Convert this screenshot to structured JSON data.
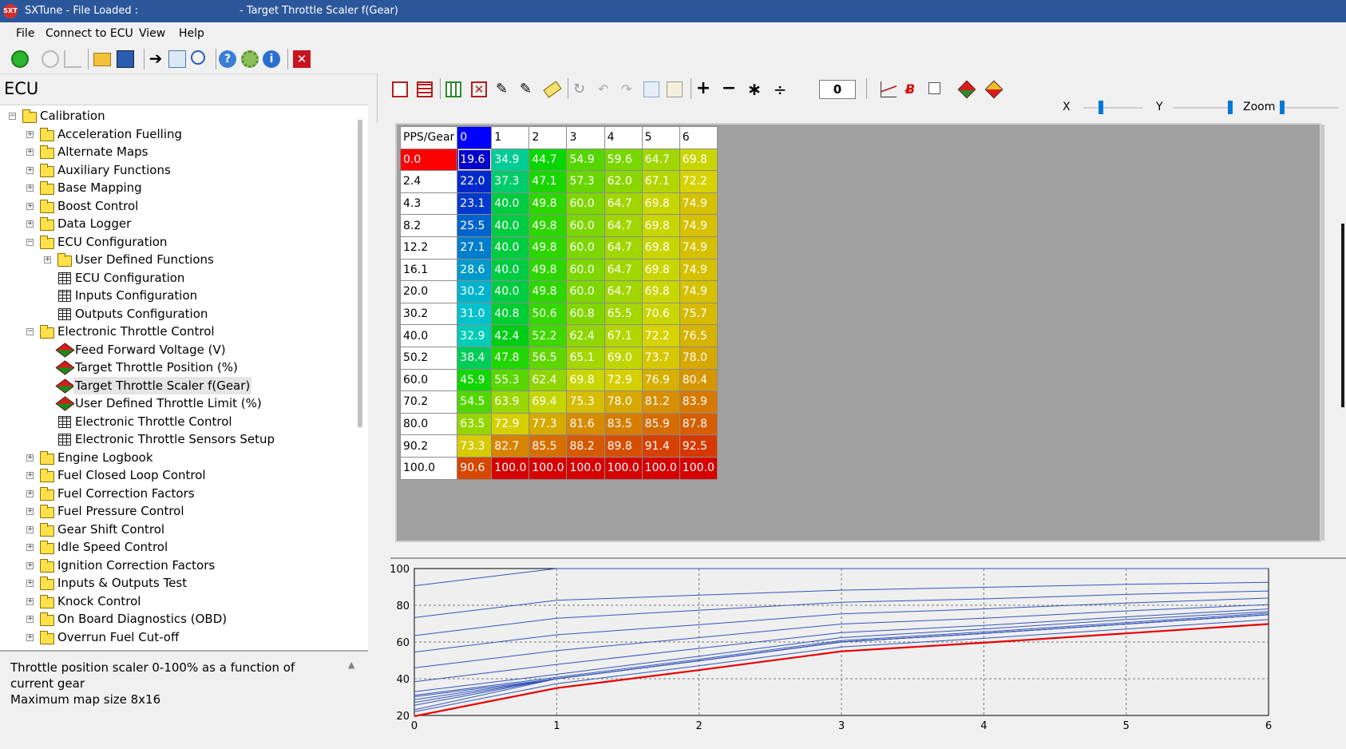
{
  "titlebar": {
    "left": "SXTune - File Loaded :",
    "right": "- Target Throttle Scaler f(Gear)",
    "logo": "SXT"
  },
  "menu": [
    "File",
    "Connect to ECU",
    "View",
    "Help"
  ],
  "toolbar_icons": [
    "power-icon",
    "refresh-icon",
    "graph-icon",
    "open-folder-icon",
    "save-icon",
    "arrow-right-icon",
    "copy-icon",
    "search-icon",
    "help-icon",
    "settings-icon",
    "info-icon",
    "close-icon"
  ],
  "left_panel": {
    "title": "ECU",
    "tree": [
      {
        "label": "Calibration",
        "level": 0,
        "icon": "folder",
        "exp": "-"
      },
      {
        "label": "Acceleration Fuelling",
        "level": 1,
        "icon": "folder",
        "exp": "+"
      },
      {
        "label": "Alternate Maps",
        "level": 1,
        "icon": "folder",
        "exp": "+"
      },
      {
        "label": "Auxiliary Functions",
        "level": 1,
        "icon": "folder",
        "exp": "+"
      },
      {
        "label": "Base Mapping",
        "level": 1,
        "icon": "folder",
        "exp": "+"
      },
      {
        "label": "Boost Control",
        "level": 1,
        "icon": "folder",
        "exp": "+"
      },
      {
        "label": "Data Logger",
        "level": 1,
        "icon": "folder",
        "exp": "+"
      },
      {
        "label": "ECU Configuration",
        "level": 1,
        "icon": "folder",
        "exp": "-"
      },
      {
        "label": "User Defined Functions",
        "level": 2,
        "icon": "folder",
        "exp": "+"
      },
      {
        "label": "ECU Configuration",
        "level": 2,
        "icon": "grid",
        "exp": ""
      },
      {
        "label": "Inputs Configuration",
        "level": 2,
        "icon": "grid",
        "exp": ""
      },
      {
        "label": "Outputs Configuration",
        "level": 2,
        "icon": "grid",
        "exp": ""
      },
      {
        "label": "Electronic Throttle Control",
        "level": 1,
        "icon": "folder",
        "exp": "-"
      },
      {
        "label": "Feed Forward Voltage (V)",
        "level": 2,
        "icon": "cube",
        "exp": ""
      },
      {
        "label": "Target Throttle Position (%)",
        "level": 2,
        "icon": "cube",
        "exp": ""
      },
      {
        "label": "Target Throttle Scaler f(Gear)",
        "level": 2,
        "icon": "cube",
        "exp": "",
        "selected": true
      },
      {
        "label": "User Defined Throttle Limit (%)",
        "level": 2,
        "icon": "cube",
        "exp": ""
      },
      {
        "label": "Electronic Throttle Control",
        "level": 2,
        "icon": "grid",
        "exp": ""
      },
      {
        "label": "Electronic Throttle Sensors Setup",
        "level": 2,
        "icon": "grid",
        "exp": ""
      },
      {
        "label": "Engine Logbook",
        "level": 1,
        "icon": "folder",
        "exp": "+"
      },
      {
        "label": "Fuel Closed Loop Control",
        "level": 1,
        "icon": "folder",
        "exp": "+"
      },
      {
        "label": "Fuel Correction Factors",
        "level": 1,
        "icon": "folder",
        "exp": "+"
      },
      {
        "label": "Fuel Pressure Control",
        "level": 1,
        "icon": "folder",
        "exp": "+"
      },
      {
        "label": "Gear Shift Control",
        "level": 1,
        "icon": "folder",
        "exp": "+"
      },
      {
        "label": "Idle Speed Control",
        "level": 1,
        "icon": "folder",
        "exp": "+"
      },
      {
        "label": "Ignition Correction Factors",
        "level": 1,
        "icon": "folder",
        "exp": "+"
      },
      {
        "label": "Inputs & Outputs Test",
        "level": 1,
        "icon": "folder",
        "exp": "+"
      },
      {
        "label": "Knock Control",
        "level": 1,
        "icon": "folder",
        "exp": "+"
      },
      {
        "label": "On Board Diagnostics (OBD)",
        "level": 1,
        "icon": "folder",
        "exp": "+"
      },
      {
        "label": "Overrun Fuel Cut-off",
        "level": 1,
        "icon": "folder",
        "exp": "+"
      }
    ],
    "description": [
      "Throttle position scaler 0-100% as a function of current gear",
      "Maximum map size 8x16"
    ]
  },
  "map_toolbar": {
    "icons": [
      "insert-row-icon",
      "delete-row-icon",
      "insert-col-icon",
      "delete-col-icon",
      "edit-icon",
      "edit-multi-icon",
      "eraser-icon",
      "rotate-icon",
      "undo-icon",
      "redo-icon",
      "copy-icon",
      "paste-icon",
      "plus-icon",
      "minus-icon",
      "multiply-icon",
      "divide-icon",
      "chart-icon",
      "x-red-icon",
      "checkbox-icon",
      "cube-red-icon",
      "cube-icon"
    ],
    "value": "0",
    "plus": "+",
    "minus": "−",
    "multiply": "∗",
    "divide": "÷",
    "x_label": "X",
    "y_label": "Y",
    "zoom_label": "Zoom"
  },
  "map": {
    "corner": "PPS/Gear",
    "columns": [
      "0",
      "1",
      "2",
      "3",
      "4",
      "5",
      "6"
    ],
    "rows": [
      "0.0",
      "2.4",
      "4.3",
      "8.2",
      "12.2",
      "16.1",
      "20.0",
      "30.2",
      "40.0",
      "50.2",
      "60.0",
      "70.2",
      "80.0",
      "90.2",
      "100.0"
    ],
    "values": [
      [
        "19.6",
        "34.9",
        "44.7",
        "54.9",
        "59.6",
        "64.7",
        "69.8"
      ],
      [
        "22.0",
        "37.3",
        "47.1",
        "57.3",
        "62.0",
        "67.1",
        "72.2"
      ],
      [
        "23.1",
        "40.0",
        "49.8",
        "60.0",
        "64.7",
        "69.8",
        "74.9"
      ],
      [
        "25.5",
        "40.0",
        "49.8",
        "60.0",
        "64.7",
        "69.8",
        "74.9"
      ],
      [
        "27.1",
        "40.0",
        "49.8",
        "60.0",
        "64.7",
        "69.8",
        "74.9"
      ],
      [
        "28.6",
        "40.0",
        "49.8",
        "60.0",
        "64.7",
        "69.8",
        "74.9"
      ],
      [
        "30.2",
        "40.0",
        "49.8",
        "60.0",
        "64.7",
        "69.8",
        "74.9"
      ],
      [
        "31.0",
        "40.8",
        "50.6",
        "60.8",
        "65.5",
        "70.6",
        "75.7"
      ],
      [
        "32.9",
        "42.4",
        "52.2",
        "62.4",
        "67.1",
        "72.2",
        "76.5"
      ],
      [
        "38.4",
        "47.8",
        "56.5",
        "65.1",
        "69.0",
        "73.7",
        "78.0"
      ],
      [
        "45.9",
        "55.3",
        "62.4",
        "69.8",
        "72.9",
        "76.9",
        "80.4"
      ],
      [
        "54.5",
        "63.9",
        "69.4",
        "75.3",
        "78.0",
        "81.2",
        "83.9"
      ],
      [
        "63.5",
        "72.9",
        "77.3",
        "81.6",
        "83.5",
        "85.9",
        "87.8"
      ],
      [
        "73.3",
        "82.7",
        "85.5",
        "88.2",
        "89.8",
        "91.4",
        "92.5"
      ],
      [
        "90.6",
        "100.0",
        "100.0",
        "100.0",
        "100.0",
        "100.0",
        "100.0"
      ]
    ],
    "active_row": 0,
    "active_col": 0
  },
  "chart": {
    "y_ticks": [
      "100",
      "80",
      "60",
      "40",
      "20"
    ],
    "x_ticks": [
      "0",
      "1",
      "2",
      "3",
      "4",
      "5",
      "6"
    ],
    "ylim": [
      20,
      100
    ],
    "xlim": [
      0,
      6
    ],
    "line_color": "#3355bb",
    "highlight_color": "#e60000"
  }
}
